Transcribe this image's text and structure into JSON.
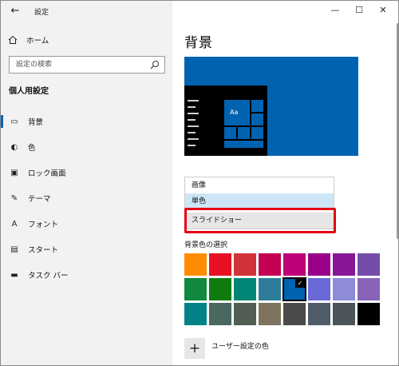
{
  "window": {
    "title": "設定"
  },
  "titlebar": {
    "back_icon": "←",
    "minimize_icon": "—",
    "maximize_icon": "☐",
    "close_icon": "✕"
  },
  "sidebar": {
    "home_label": "ホーム",
    "search_placeholder": "設定の検索",
    "section_heading": "個人用設定",
    "items": [
      {
        "label": "背景",
        "icon": "picture-icon",
        "glyph": "▭",
        "selected": true
      },
      {
        "label": "色",
        "icon": "palette-icon",
        "glyph": "◐",
        "selected": false
      },
      {
        "label": "ロック画面",
        "icon": "lock-screen-icon",
        "glyph": "▣",
        "selected": false
      },
      {
        "label": "テーマ",
        "icon": "theme-icon",
        "glyph": "✎",
        "selected": false
      },
      {
        "label": "フォント",
        "icon": "font-icon",
        "glyph": "A",
        "selected": false
      },
      {
        "label": "スタート",
        "icon": "start-icon",
        "glyph": "▤",
        "selected": false
      },
      {
        "label": "タスク バー",
        "icon": "taskbar-icon",
        "glyph": "▬",
        "selected": false
      }
    ]
  },
  "main": {
    "title": "背景",
    "preview_tile_text": "Aa",
    "dropdown_options": [
      {
        "label": "画像",
        "state": "normal"
      },
      {
        "label": "単色",
        "state": "highlighted"
      },
      {
        "label": "スライドショー",
        "state": "hovered"
      }
    ],
    "color_section_label": "背景色の選択",
    "custom_color_label": "ユーザー設定の色",
    "plus_glyph": "+",
    "check_glyph": "✓",
    "swatches": [
      "#ff8c00",
      "#e81123",
      "#d13438",
      "#c30052",
      "#bf0077",
      "#9a0089",
      "#881798",
      "#744da9",
      "#10893e",
      "#107c10",
      "#018574",
      "#2d7d9a",
      "#0063b1",
      "#6b69d6",
      "#8e8cd8",
      "#8764b8",
      "#038387",
      "#486860",
      "#525e54",
      "#7e735f",
      "#4c4a48",
      "#515c6b",
      "#4a5459",
      "#000000"
    ],
    "selected_swatch_index": 12
  },
  "colors": {
    "accent": "#0067c0",
    "highlight_border": "#e60012",
    "preview_blue": "#0063b1"
  }
}
